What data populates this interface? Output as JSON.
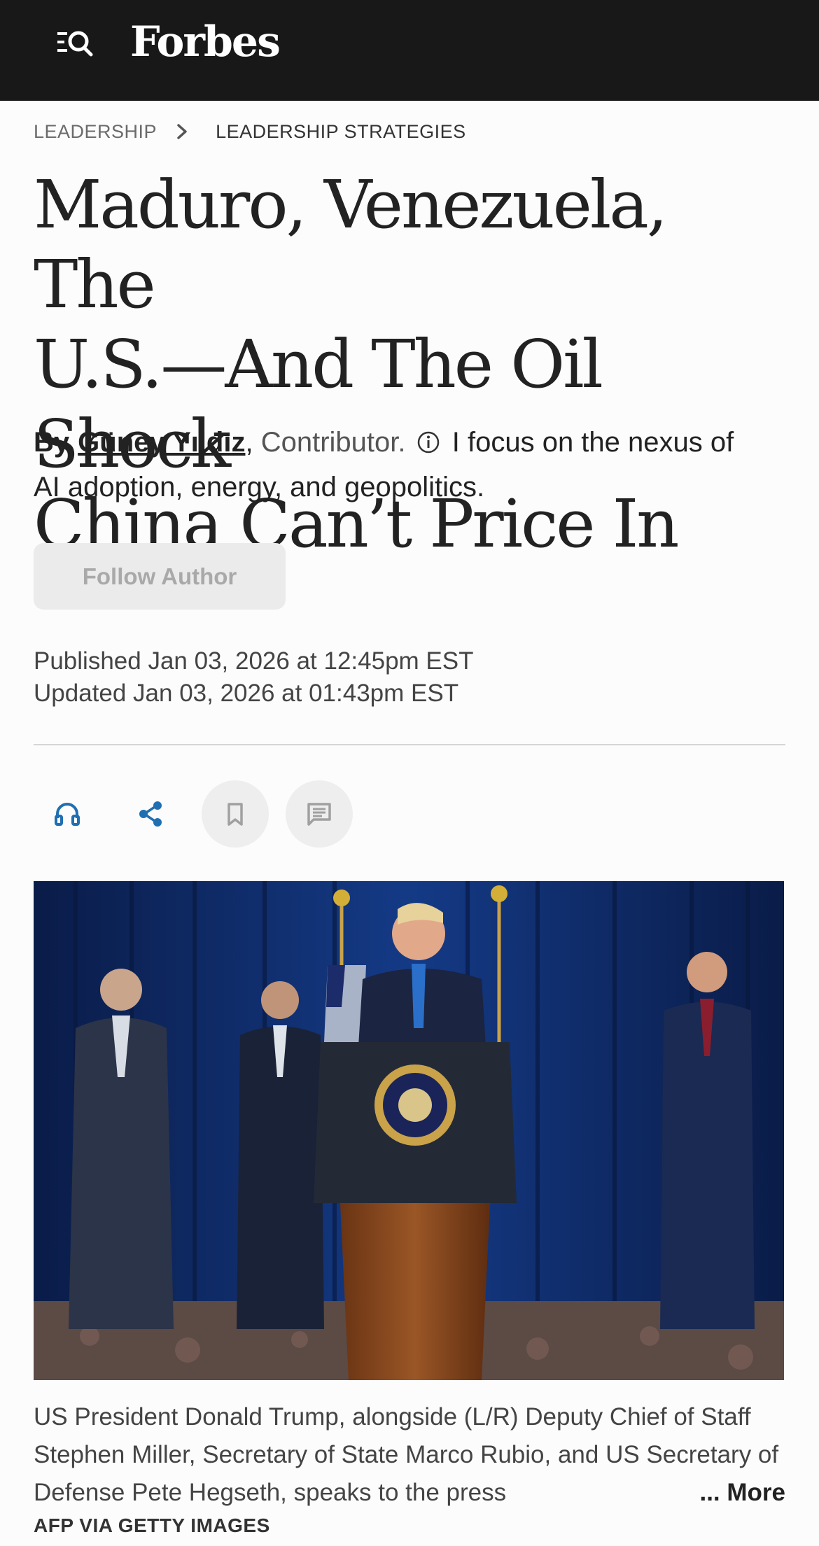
{
  "header": {
    "logo": "Forbes",
    "menu_icon": "menu-search-icon"
  },
  "breadcrumb": {
    "section": "LEADERSHIP",
    "separator_icon": "chevron-right-icon",
    "subsection": "LEADERSHIP STRATEGIES"
  },
  "article": {
    "headline_lines": [
      "Maduro, Venezuela, The",
      "U.S.—And The Oil Shock",
      "China Can’t Price In"
    ],
    "byline": {
      "by": "By",
      "author": "Güney Yıldız",
      "comma": ",",
      "role": "Contributor.",
      "info_icon": "info-icon",
      "bio": "I focus on the nexus of AI adoption, energy, and geopolitics."
    },
    "follow_label": "Follow Author",
    "published": "Published Jan 03, 2026 at 12:45pm EST",
    "updated": "Updated Jan 03, 2026 at 01:43pm EST",
    "actions": [
      {
        "name": "listen",
        "icon": "headphones-icon"
      },
      {
        "name": "share",
        "icon": "share-icon"
      },
      {
        "name": "save",
        "icon": "bookmark-icon"
      },
      {
        "name": "comments",
        "icon": "comment-icon"
      }
    ],
    "image": {
      "caption": "US President Donald Trump, alongside (L/R) Deputy Chief of Staff Stephen Miller, Secretary of State Marco Rubio, and US Secretary of Defense Pete Hegseth, speaks to the press",
      "more_label": "... More",
      "credit": "AFP VIA GETTY IMAGES"
    }
  },
  "colors": {
    "header_bg": "#181818",
    "accent_blue": "#1f6fb2",
    "page_bg": "#fcfcfc"
  }
}
